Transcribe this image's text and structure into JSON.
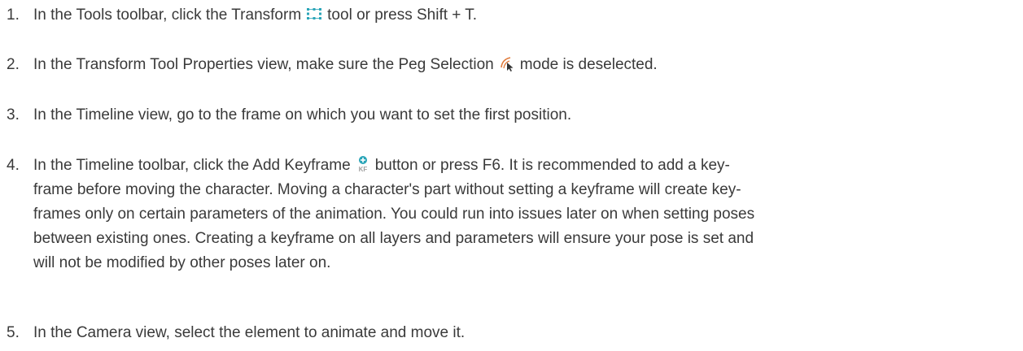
{
  "steps": [
    {
      "number": "1.",
      "before": "In the Tools toolbar, click the Transform",
      "icon": "transform-tool-icon",
      "after": "tool or press Shift + T."
    },
    {
      "number": "2.",
      "before": "In the Transform Tool Properties view, make sure the Peg Selection",
      "icon": "peg-selection-icon",
      "after": "mode is deselected."
    },
    {
      "number": "3.",
      "text": "In the Timeline view, go to the frame on which you want to set the first position."
    },
    {
      "number": "4.",
      "before": "In the Timeline toolbar, click the Add Keyframe",
      "icon": "add-keyframe-icon",
      "icon_label": "KF",
      "after": "button or press F6. It is recommended to add a key-",
      "lines": [
        "frame before moving the character. Moving a character's part without setting a keyframe will create key-",
        "frames only on certain parameters of the animation. You could run into issues later on when setting poses",
        "between existing ones. Creating a keyframe on all layers and parameters will ensure your pose is set and",
        "will not be modified by other poses later on."
      ]
    },
    {
      "number": "5.",
      "text": "In the Camera view, select the element to animate and move it."
    }
  ],
  "colors": {
    "text": "#3a3a3a",
    "transform_icon": "#2aa5b8",
    "peg_icon_arc": "#e07a3a",
    "keyframe_icon": "#2aa5b8"
  }
}
